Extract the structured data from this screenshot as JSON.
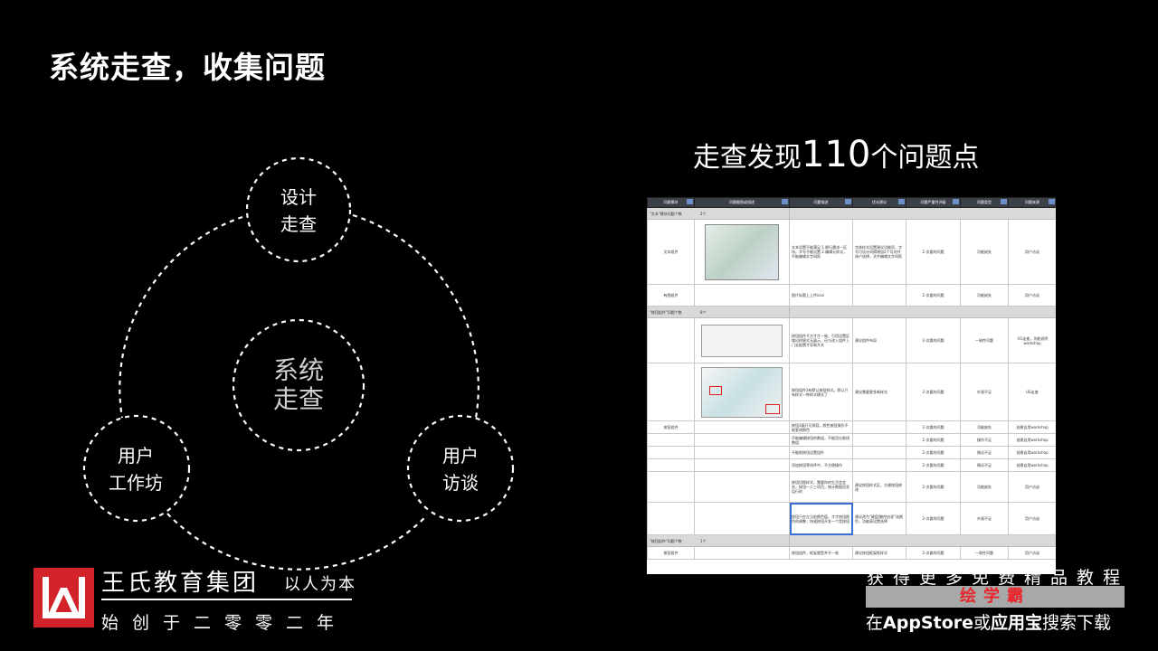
{
  "page": {
    "title": "系统走查，收集问题"
  },
  "diagram": {
    "center": "系统\n走查",
    "nodes": {
      "design": "设计\n走查",
      "workshop": "用户\n工作坊",
      "interview": "用户\n访谈"
    }
  },
  "finding": {
    "prefix": "走查发现",
    "number": "110",
    "suffix": "个问题点"
  },
  "spreadsheet": {
    "headers": [
      "问题模块",
      "问题截图或描述",
      "问题描述",
      "优化建议",
      "问题严重性评级",
      "问题类型",
      "问题来源"
    ],
    "groups": [
      {
        "label": "\"文本\"模块问题个数",
        "count": "2个",
        "rows": [
          {
            "module": "文本组件",
            "desc": "文本设置不能满足 1.换行需求一区块。字号不能设置 2.编辑元样式，不能编辑文字间距",
            "suggest": "字体样式设置建议功能项，字号可设计间隔增加2个可对并体户选择，文件编辑文字间距",
            "level": "2-次要的问题",
            "type": "功能缺失",
            "source": "用户访谈",
            "img": "a"
          },
          {
            "module": "有图组件",
            "desc": "图片标题上上传icon",
            "suggest": "",
            "level": "2-次要的问题",
            "type": "功能缺失",
            "source": "用户访谈",
            "img": ""
          }
        ]
      },
      {
        "label": "\"按钮组件\"问题个数",
        "count": "8个",
        "rows": [
          {
            "module": "",
            "desc": "按钮组件不方才才一致，引用设置区域出样模式无展示，还与进入组件上门去配置才导致开关",
            "suggest": "建议组件布局",
            "level": "2-次要的问题",
            "type": "一致性问题",
            "source": "-01走查，功能说明 workshop",
            "img": "b"
          },
          {
            "module": "",
            "desc": "按钮组件3有默认按钮样式，默认只有样式一种样式模式了",
            "suggest": "建议需要更多新样式",
            "level": "2-次要的问题",
            "type": "外观不足",
            "source": "UE走查",
            "img": "c"
          },
          {
            "module": "按钮组件",
            "desc": "按钮3展开可排容，颜色按钮操作不能更改颜色",
            "suggest": "",
            "level": "2-次要的问题",
            "type": "功能缺失",
            "source": "创建自用workshop",
            "img": ""
          },
          {
            "module": "",
            "desc": "不能编辑按钮的数组，不能用分割线数组",
            "suggest": "",
            "level": "2-次要的问题",
            "type": "操作不足",
            "source": "创建自用workshop",
            "img": ""
          },
          {
            "module": "",
            "desc": "不能地按钮设置组件",
            "suggest": "",
            "level": "2-次要的问题",
            "type": "情况不足",
            "source": "创建自用workshop",
            "img": ""
          },
          {
            "module": "",
            "desc": "添加按钮等排序中，不方便操作",
            "suggest": "",
            "level": "2-次要的问题",
            "type": "情况不足",
            "source": "创建自用workshop",
            "img": ""
          },
          {
            "module": "",
            "desc": "按钮切换样式，需要你的生活会会务，按钮一二三项目，统计数据信息运行的",
            "suggest": "建议按钮样式区，方便按钮修改",
            "level": "2-次要的问题",
            "type": "功能缺失",
            "source": "用户访谈",
            "img": ""
          },
          {
            "module": "",
            "desc": "按钮只在左当前颜色值，才才按钮颜色的调整，快速按钮开发一个是按钮",
            "suggest": "建议改为\"键盘/触控启发\"选颜色，功能表设置选择",
            "level": "2-次要的问题",
            "type": "外观不足",
            "source": "用户访谈",
            "img": "sel"
          }
        ]
      },
      {
        "label": "\"按钮组件\"问题个数",
        "count": "1个",
        "rows": [
          {
            "module": "按钮组件",
            "desc": "按钮组件，框架就是并不一致",
            "suggest": "建议按钮框架框样式",
            "level": "2-次要的问题",
            "type": "一致性问题",
            "source": "用户访谈",
            "img": ""
          }
        ]
      }
    ]
  },
  "brand": {
    "name": "王氏教育集团",
    "motto": "以人为本",
    "since": "始创于二零零二年"
  },
  "promo": {
    "line1": "获得更多免费精品教程",
    "app_name": "绘学霸",
    "line3_pre": "在",
    "line3_store": "AppStore",
    "line3_or": "或",
    "line3_market": "应用宝",
    "line3_post": "搜索下载"
  },
  "colors": {
    "background": "#000000",
    "logo_red": "#d2232a",
    "promo_red": "#e8262c",
    "sheet_header": "#3a3f48"
  }
}
